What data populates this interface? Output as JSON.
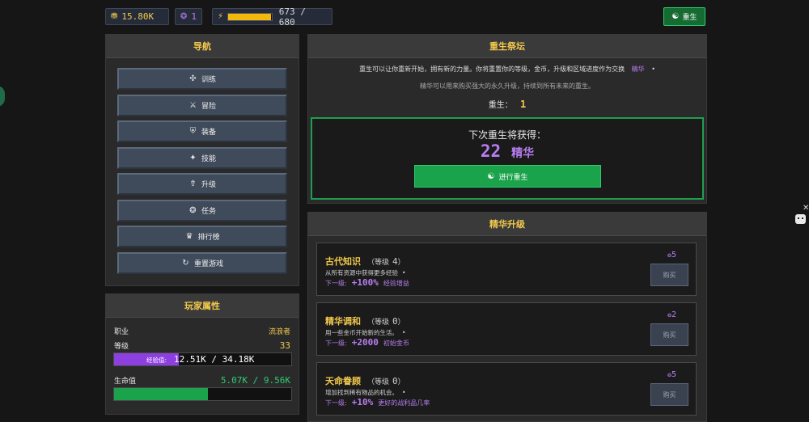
{
  "topbar": {
    "gold": "15.80K",
    "essence": "1",
    "energy_value": "673 / 680",
    "energy_progress": 0.99,
    "rebirth_label": "重生"
  },
  "nav": {
    "title": "导航",
    "items": [
      {
        "label": "训练",
        "icon": "dumbbell-icon",
        "glyph": "✣"
      },
      {
        "label": "冒险",
        "icon": "crossed-swords-icon",
        "glyph": "⚔"
      },
      {
        "label": "装备",
        "icon": "armor-icon",
        "glyph": "⛨"
      },
      {
        "label": "技能",
        "icon": "skill-icon",
        "glyph": "✦"
      },
      {
        "label": "升级",
        "icon": "upgrade-icon",
        "glyph": "⇮"
      },
      {
        "label": "任务",
        "icon": "quest-icon",
        "glyph": "❂"
      },
      {
        "label": "排行榜",
        "icon": "trophy-icon",
        "glyph": "♛"
      },
      {
        "label": "重置游戏",
        "icon": "reset-icon",
        "glyph": "↻"
      }
    ]
  },
  "player": {
    "title": "玩家属性",
    "class_label": "职业",
    "class_value": "流浪者",
    "level_label": "等级",
    "level_value": "33",
    "exp_label": "经验值",
    "exp_value": "12.51K / 34.18K",
    "exp_progress": 0.366,
    "hp_label": "生命值",
    "hp_value": "5.07K / 9.56K",
    "hp_progress": 0.53
  },
  "rebirth": {
    "title": "重生祭坛",
    "desc1": "重生可以让你重新开始，拥有新的力量。你将重置你的等级，金币，升级和区域进度作为交换",
    "desc1_highlight": "精华",
    "desc2": "精华可以用来购买强大的永久升级，持续到所有未来的重生。",
    "count_label": "重生：",
    "count_value": "1",
    "next_label": "下次重生将获得：",
    "next_amount": "22",
    "next_unit": "精华",
    "button_label": "进行重生"
  },
  "essence_upgrades": {
    "title": "精华升级",
    "level_word": "等级",
    "next_word": "下一级:",
    "buy_label": "购买",
    "items": [
      {
        "name": "古代知识",
        "level": "4",
        "desc": "从所有资源中获得更多经验",
        "next": "+100%",
        "effect": "经验增益",
        "cost": "5"
      },
      {
        "name": "精华调和",
        "level": "0",
        "desc": "用一些金币开始新的生活。",
        "next": "+2000",
        "effect": "初始金币",
        "cost": "2"
      },
      {
        "name": "天命眷顾",
        "level": "0",
        "desc": "增加找到稀有物品的机会。",
        "next": "+10%",
        "effect": "更好的战利品几率",
        "cost": "5"
      }
    ]
  },
  "colors": {
    "accent_gold": "#f2c94c",
    "essence_purple": "#b77ef0",
    "rebirth_green": "#1aa34a"
  }
}
